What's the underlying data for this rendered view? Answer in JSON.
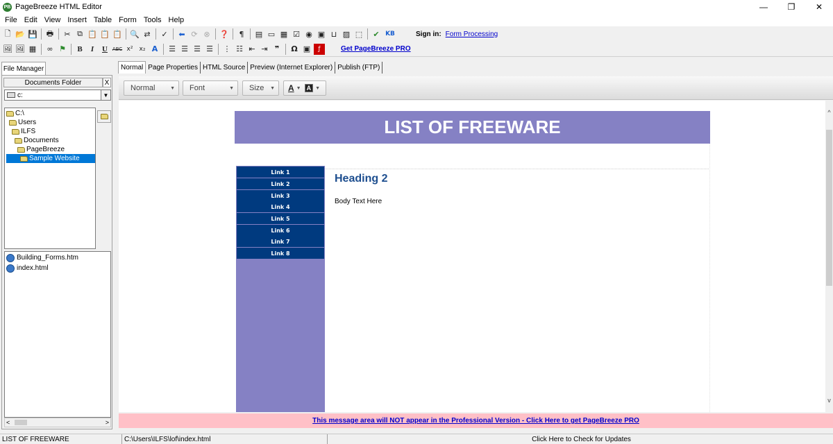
{
  "window": {
    "title": "PageBreeze HTML Editor",
    "app_icon_text": "PB",
    "controls": [
      "—",
      "❐",
      "✕"
    ]
  },
  "menu": [
    "File",
    "Edit",
    "View",
    "Insert",
    "Table",
    "Form",
    "Tools",
    "Help"
  ],
  "toolbar1": {
    "sign_in_label": "Sign in:",
    "sign_in_link": "Form Processing",
    "kb_label": "KB"
  },
  "toolbar2": {
    "bold": "B",
    "italic": "I",
    "underline": "U",
    "get_pro_link": "Get PageBreeze PRO"
  },
  "left_panel": {
    "tab_label": "File Manager",
    "documents_folder_label": "Documents Folder",
    "close_label": "X",
    "drive_value": "c:",
    "folders": [
      "C:\\",
      "Users",
      "ILFS",
      "Documents",
      "PageBreeze",
      "Sample Website"
    ],
    "selected_folder_index": 5,
    "files": [
      "Building_Forms.htm",
      "index.html"
    ]
  },
  "editor_tabs": [
    "Normal",
    "Page Properties",
    "HTML Source",
    "Preview (Internet Explorer)",
    "Publish (FTP)"
  ],
  "active_editor_tab": 0,
  "format_bar": {
    "style_value": "Normal",
    "font_value": "Font",
    "size_value": "Size",
    "font_color_label": "A",
    "highlight_label": "A"
  },
  "page": {
    "banner_title": "LIST OF FREEWARE",
    "nav_links": [
      "Link 1",
      "Link 2",
      "Link 3",
      "Link 4",
      "Link 5",
      "Link 6",
      "Link 7",
      "Link 8"
    ],
    "heading": "Heading 2",
    "body_text": "Body Text Here",
    "colors": {
      "banner": "#8581c4",
      "nav_link": "#003a7f",
      "heading": "#1d4e8f"
    }
  },
  "message_bar": {
    "text": "This message area will NOT appear in the Professional Version  -  Click Here to get PageBreeze PRO",
    "color": "#ffc0c7"
  },
  "status_bar": {
    "page_title": "LIST OF FREEWARE",
    "file_path": "C:\\Users\\ILFS\\lof\\index.html",
    "updates": "Click Here to Check for Updates"
  }
}
